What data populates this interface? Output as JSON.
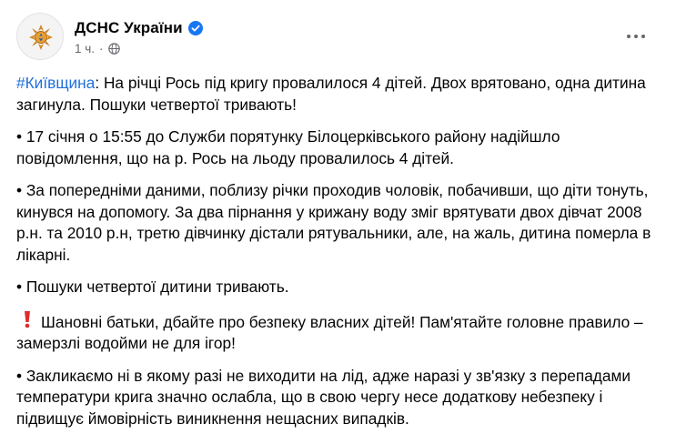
{
  "post": {
    "page_name": "ДСНС України",
    "time": "1 ч.",
    "separator": "·",
    "hashtag": "#Київщина",
    "headline_rest": ": На річці Рось під кригу провалилося 4 дітей. Двох врятовано, одна дитина загинула. Пошуки четвертої тривають!",
    "paragraphs": [
      "• 17 січня о 15:55 до Служби порятунку Білоцерківського району надійшло повідомлення, що на р. Рось на льоду провалилось 4 дітей.",
      "• За попередніми даними, поблизу річки проходив чоловік, побачивши, що діти тонуть, кинувся на допомогу. За два пірнання у крижану воду зміг врятувати двох дівчат 2008 р.н. та 2010 р.н, третю дівчинку дістали рятувальники, але, на жаль, дитина померла в лікарні.",
      "• Пошуки четвертої дитини тривають.",
      "Шановні батьки, дбайте про безпеку власних дітей! Пам'ятайте головне правило – замерзлі водойми не для ігор!",
      "• Закликаємо ні в якому разі не виходити на лід, адже наразі у зв'язку з перепадами температури крига значно ослабла, що в свою чергу несе додаткову небезпеку і підвищує ймовірність виникнення нещасних випадків."
    ]
  },
  "icons": {
    "avatar": "dsns-emblem-logo",
    "verified": "verified-badge-icon",
    "audience": "globe-icon",
    "more": "more-options-icon",
    "warning": "red-exclamation-icon"
  },
  "colors": {
    "link": "#216fdb",
    "verified": "#1877f2",
    "emblem": "#d48a1f",
    "exclamation": "#e02b2b",
    "meta": "#65676b"
  }
}
